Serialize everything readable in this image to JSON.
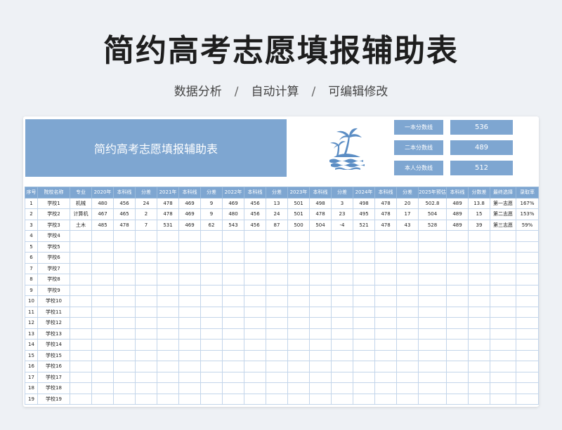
{
  "page": {
    "title": "简约高考志愿填报辅助表",
    "subtitle": [
      "数据分析",
      "自动计算",
      "可编辑修改"
    ],
    "subtitle_sep": "/"
  },
  "banner": {
    "title": "简约高考志愿填报辅助表"
  },
  "icon": "palm-island-icon",
  "scores": [
    {
      "label": "一本分数线",
      "value": "536"
    },
    {
      "label": "二本分数线",
      "value": "489"
    },
    {
      "label": "本人分数线",
      "value": "512"
    }
  ],
  "table": {
    "headers": [
      "序号",
      "院校名称",
      "专业",
      "2020年",
      "本科线",
      "分差",
      "2021年",
      "本科线",
      "分差",
      "2022年",
      "本科线",
      "分差",
      "2023年",
      "本科线",
      "分差",
      "2024年",
      "本科线",
      "分差",
      "2025年预估",
      "本科线",
      "分数差",
      "最终选择",
      "录取率"
    ],
    "rows": [
      [
        "1",
        "学校1",
        "机械",
        "480",
        "456",
        "24",
        "478",
        "469",
        "9",
        "469",
        "456",
        "13",
        "501",
        "498",
        "3",
        "498",
        "478",
        "20",
        "502.8",
        "489",
        "13.8",
        "第一志愿",
        "167%"
      ],
      [
        "2",
        "学校2",
        "计算机",
        "467",
        "465",
        "2",
        "478",
        "469",
        "9",
        "480",
        "456",
        "24",
        "501",
        "478",
        "23",
        "495",
        "478",
        "17",
        "504",
        "489",
        "15",
        "第二志愿",
        "153%"
      ],
      [
        "3",
        "学校3",
        "土木",
        "485",
        "478",
        "7",
        "531",
        "469",
        "62",
        "543",
        "456",
        "87",
        "500",
        "504",
        "-4",
        "521",
        "478",
        "43",
        "528",
        "489",
        "39",
        "第三志愿",
        "59%"
      ],
      [
        "4",
        "学校4",
        "",
        "",
        "",
        "",
        "",
        "",
        "",
        "",
        "",
        "",
        "",
        "",
        "",
        "",
        "",
        "",
        "",
        "",
        "",
        "",
        ""
      ],
      [
        "5",
        "学校5",
        "",
        "",
        "",
        "",
        "",
        "",
        "",
        "",
        "",
        "",
        "",
        "",
        "",
        "",
        "",
        "",
        "",
        "",
        "",
        "",
        ""
      ],
      [
        "6",
        "学校6",
        "",
        "",
        "",
        "",
        "",
        "",
        "",
        "",
        "",
        "",
        "",
        "",
        "",
        "",
        "",
        "",
        "",
        "",
        "",
        "",
        ""
      ],
      [
        "7",
        "学校7",
        "",
        "",
        "",
        "",
        "",
        "",
        "",
        "",
        "",
        "",
        "",
        "",
        "",
        "",
        "",
        "",
        "",
        "",
        "",
        "",
        ""
      ],
      [
        "8",
        "学校8",
        "",
        "",
        "",
        "",
        "",
        "",
        "",
        "",
        "",
        "",
        "",
        "",
        "",
        "",
        "",
        "",
        "",
        "",
        "",
        "",
        ""
      ],
      [
        "9",
        "学校9",
        "",
        "",
        "",
        "",
        "",
        "",
        "",
        "",
        "",
        "",
        "",
        "",
        "",
        "",
        "",
        "",
        "",
        "",
        "",
        "",
        ""
      ],
      [
        "10",
        "学校10",
        "",
        "",
        "",
        "",
        "",
        "",
        "",
        "",
        "",
        "",
        "",
        "",
        "",
        "",
        "",
        "",
        "",
        "",
        "",
        "",
        ""
      ],
      [
        "11",
        "学校11",
        "",
        "",
        "",
        "",
        "",
        "",
        "",
        "",
        "",
        "",
        "",
        "",
        "",
        "",
        "",
        "",
        "",
        "",
        "",
        "",
        ""
      ],
      [
        "12",
        "学校12",
        "",
        "",
        "",
        "",
        "",
        "",
        "",
        "",
        "",
        "",
        "",
        "",
        "",
        "",
        "",
        "",
        "",
        "",
        "",
        "",
        ""
      ],
      [
        "13",
        "学校13",
        "",
        "",
        "",
        "",
        "",
        "",
        "",
        "",
        "",
        "",
        "",
        "",
        "",
        "",
        "",
        "",
        "",
        "",
        "",
        "",
        ""
      ],
      [
        "14",
        "学校14",
        "",
        "",
        "",
        "",
        "",
        "",
        "",
        "",
        "",
        "",
        "",
        "",
        "",
        "",
        "",
        "",
        "",
        "",
        "",
        "",
        ""
      ],
      [
        "15",
        "学校15",
        "",
        "",
        "",
        "",
        "",
        "",
        "",
        "",
        "",
        "",
        "",
        "",
        "",
        "",
        "",
        "",
        "",
        "",
        "",
        "",
        ""
      ],
      [
        "16",
        "学校16",
        "",
        "",
        "",
        "",
        "",
        "",
        "",
        "",
        "",
        "",
        "",
        "",
        "",
        "",
        "",
        "",
        "",
        "",
        "",
        "",
        ""
      ],
      [
        "17",
        "学校17",
        "",
        "",
        "",
        "",
        "",
        "",
        "",
        "",
        "",
        "",
        "",
        "",
        "",
        "",
        "",
        "",
        "",
        "",
        "",
        "",
        ""
      ],
      [
        "18",
        "学校18",
        "",
        "",
        "",
        "",
        "",
        "",
        "",
        "",
        "",
        "",
        "",
        "",
        "",
        "",
        "",
        "",
        "",
        "",
        "",
        "",
        ""
      ],
      [
        "19",
        "学校19",
        "",
        "",
        "",
        "",
        "",
        "",
        "",
        "",
        "",
        "",
        "",
        "",
        "",
        "",
        "",
        "",
        "",
        "",
        "",
        "",
        ""
      ]
    ]
  },
  "colors": {
    "accent": "#7ea6d1",
    "grid": "#c3d5ea",
    "background": "#eef1f5"
  }
}
